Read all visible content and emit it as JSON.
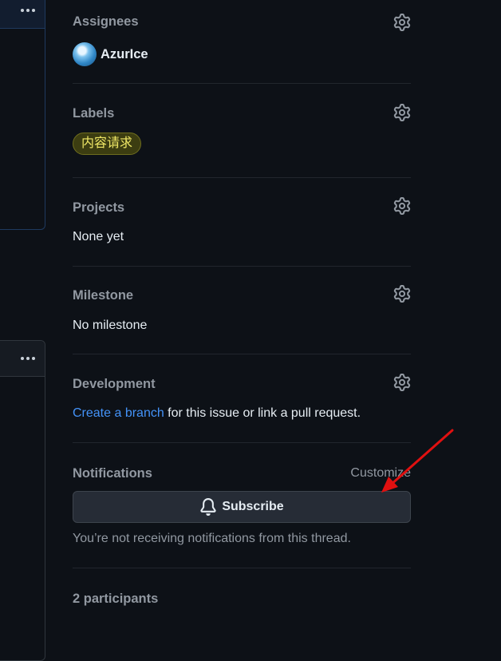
{
  "sidebar": {
    "assignees": {
      "title": "Assignees",
      "users": [
        {
          "name": "AzurIce"
        }
      ]
    },
    "labels": {
      "title": "Labels",
      "items": [
        {
          "name": "内容请求",
          "color": "#f0e866"
        }
      ]
    },
    "projects": {
      "title": "Projects",
      "value": "None yet"
    },
    "milestone": {
      "title": "Milestone",
      "value": "No milestone"
    },
    "development": {
      "title": "Development",
      "link_text": "Create a branch",
      "rest_text": " for this issue or link a pull request."
    },
    "notifications": {
      "title": "Notifications",
      "customize": "Customize",
      "subscribe_label": "Subscribe",
      "status_text": "You’re not receiving notifications from this thread."
    },
    "participants": {
      "title": "2 participants"
    }
  },
  "colors": {
    "background": "#0d1117",
    "link": "#4493f8",
    "annotation_arrow": "#e01010"
  }
}
